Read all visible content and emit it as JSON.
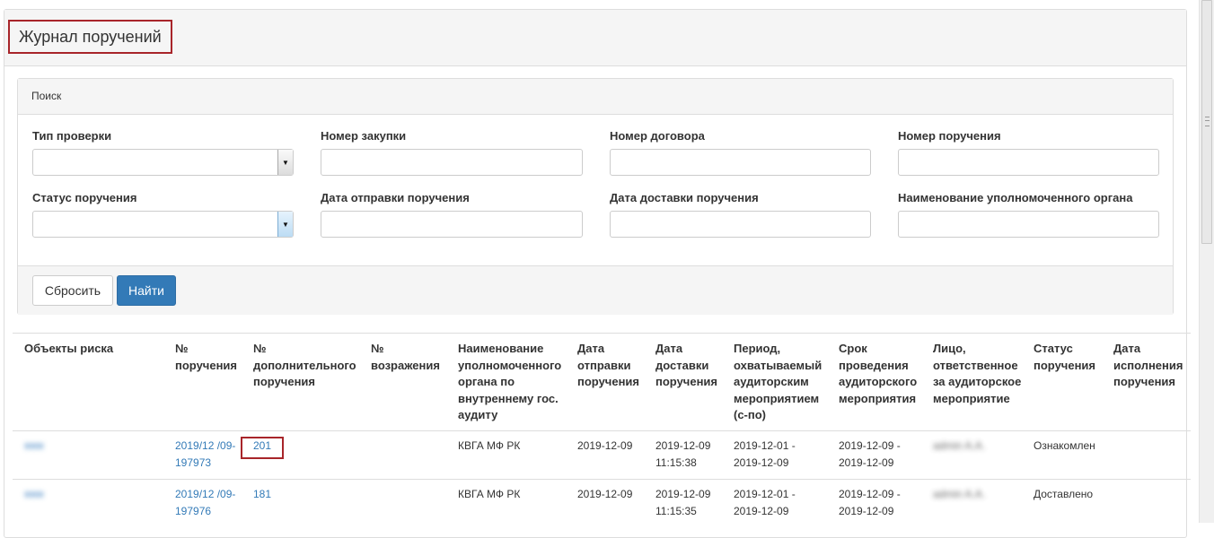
{
  "page": {
    "title": "Журнал поручений"
  },
  "search": {
    "title": "Поиск",
    "fields": [
      {
        "label": "Тип проверки",
        "value": ""
      },
      {
        "label": "Номер закупки",
        "value": ""
      },
      {
        "label": "Номер договора",
        "value": ""
      },
      {
        "label": "Номер поручения",
        "value": ""
      },
      {
        "label": "Статус поручения",
        "value": ""
      },
      {
        "label": "Дата отправки поручения",
        "value": ""
      },
      {
        "label": "Дата доставки поручения",
        "value": ""
      },
      {
        "label": "Наименование уполномоченного органа",
        "value": ""
      }
    ],
    "reset_label": "Сбросить",
    "find_label": "Найти"
  },
  "table": {
    "columns": [
      "Объекты риска",
      "№ поручения",
      "№ дополнительного поручения",
      "№ возражения",
      "Наименование уполномоченного органа по внутреннему гос. аудиту",
      "Дата отправки поручения",
      "Дата доставки поручения",
      "Период, охватываемый аудиторским мероприятием (с-по)",
      "Срок проведения аудиторского мероприятия",
      "Лицо, ответственное за аудиторское мероприятие",
      "Статус поручения",
      "Дата исполнения поручения"
    ],
    "rows": [
      {
        "risk_object": "■■■",
        "order_no": "2019/12 /09-197973",
        "additional_no": "201",
        "objection_no": "",
        "authority": "КВГА МФ РК",
        "sent_date": "2019-12-09",
        "delivered": "2019-12-09 11:15:38",
        "period": "2019-12-01 - 2019-12-09",
        "term": "2019-12-09 - 2019-12-09",
        "responsible": "admin A.A.",
        "status": "Ознакомлен",
        "exec_date": ""
      },
      {
        "risk_object": "■■■",
        "order_no": "2019/12 /09-197976",
        "additional_no": "181",
        "objection_no": "",
        "authority": "КВГА МФ РК",
        "sent_date": "2019-12-09",
        "delivered": "2019-12-09 11:15:35",
        "period": "2019-12-01 - 2019-12-09",
        "term": "2019-12-09 - 2019-12-09",
        "responsible": "admin A.A.",
        "status": "Доставлено",
        "exec_date": ""
      }
    ]
  }
}
